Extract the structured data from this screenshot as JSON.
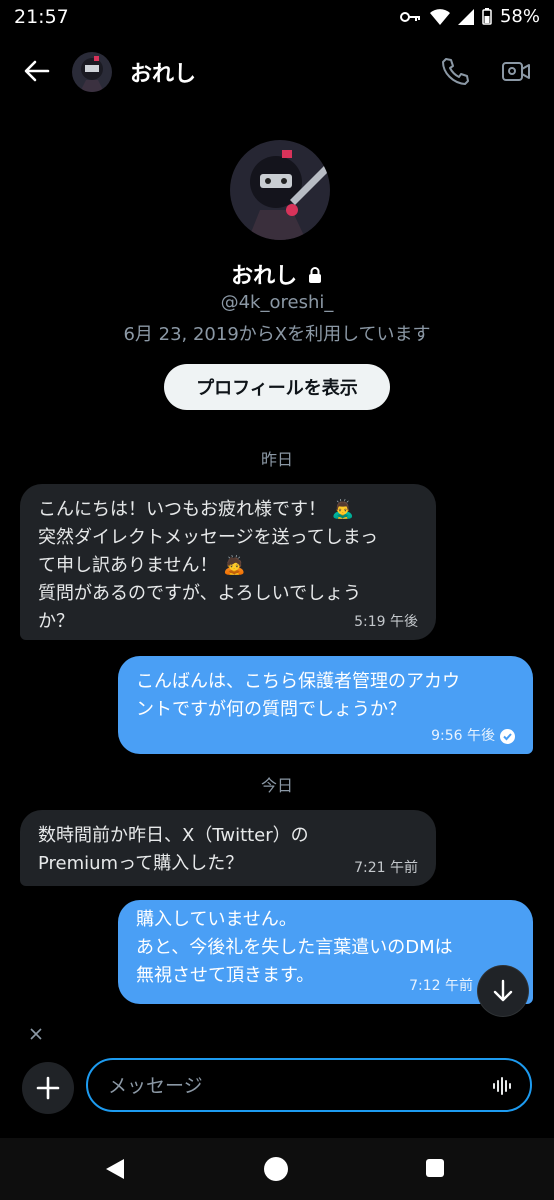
{
  "status_bar": {
    "time": "21:57",
    "battery": "58%"
  },
  "header": {
    "name": "おれし"
  },
  "profile": {
    "name": "おれし",
    "handle": "@4k_oreshi_",
    "since": "6月 23, 2019からXを利用しています",
    "button_label": "プロフィールを表示"
  },
  "separators": {
    "yesterday": "昨日",
    "today": "今日"
  },
  "messages": [
    {
      "direction": "in",
      "lines": [
        "こんにちは！いつもお疲れ様です！ 🙇‍♂️",
        "突然ダイレクトメッセージを送ってしまっ",
        "て申し訳ありません！ 🙇",
        "質問があるのですが、よろしいでしょう",
        "か？"
      ],
      "time": "5:19 午後"
    },
    {
      "direction": "out",
      "lines": [
        "こんばんは、こちら保護者管理のアカウ",
        "ントですが何の質問でしょうか？"
      ],
      "time": "9:56 午後"
    },
    {
      "direction": "in",
      "lines": [
        "数時間前か昨日、X（Twitter）の",
        "Premiumって購入した？"
      ],
      "time": "7:21 午前"
    },
    {
      "direction": "out",
      "lines": [
        "購入していません。",
        "あと、今後礼を失した言葉遣いのDMは",
        "無視させて頂きます。"
      ],
      "time": "7:12 午前"
    }
  ],
  "composer": {
    "placeholder": "メッセージ"
  },
  "icons": {
    "back": "arrow-left-icon",
    "call": "phone-icon",
    "video": "video-icon",
    "scroll": "arrow-down-icon",
    "plus": "plus-icon",
    "voice": "voice-wave-icon",
    "lock": "lock-icon",
    "read": "check-circle-icon"
  },
  "colors": {
    "accent": "#1d9bf0",
    "outgoing_bubble": "#4a9ff5",
    "incoming_bubble": "#202327"
  }
}
